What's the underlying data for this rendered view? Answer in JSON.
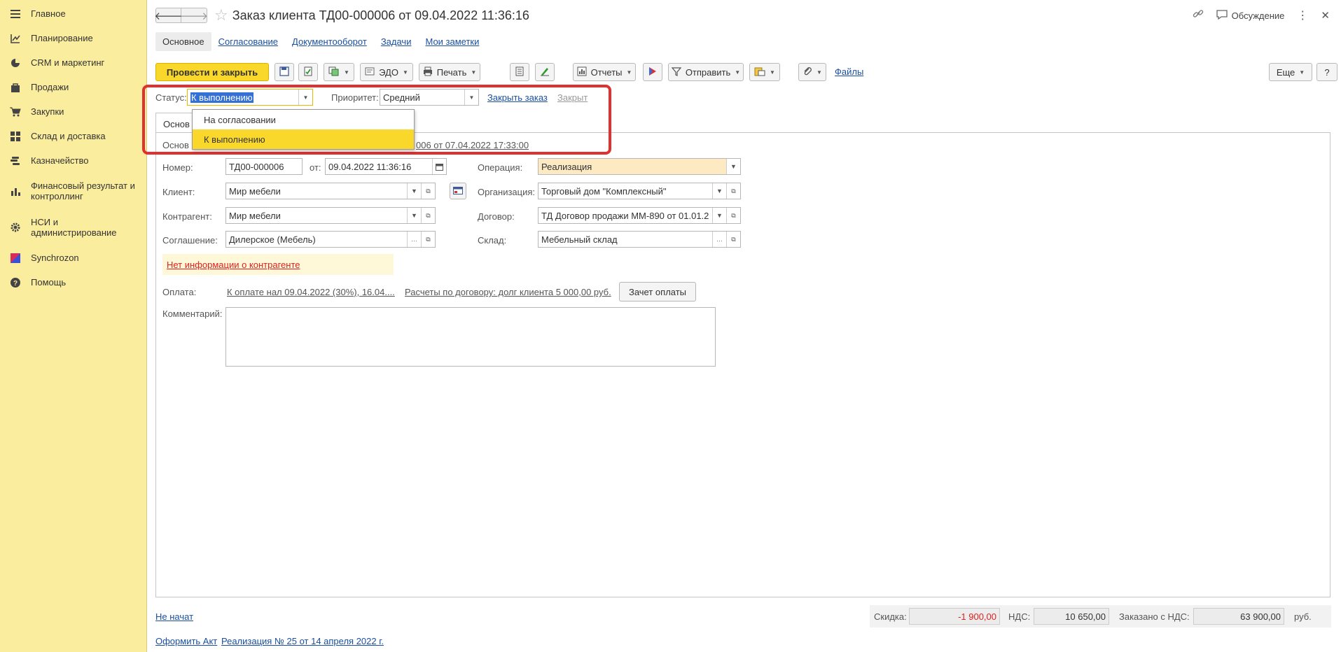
{
  "sidebar": {
    "items": [
      {
        "label": "Главное",
        "icon": "menu-icon"
      },
      {
        "label": "Планирование",
        "icon": "planning-icon"
      },
      {
        "label": "CRM и маркетинг",
        "icon": "pie-chart-icon"
      },
      {
        "label": "Продажи",
        "icon": "shopping-bag-icon"
      },
      {
        "label": "Закупки",
        "icon": "cart-icon"
      },
      {
        "label": "Склад и доставка",
        "icon": "warehouse-icon"
      },
      {
        "label": "Казначейство",
        "icon": "coins-icon"
      },
      {
        "label": "Финансовый результат и контроллинг",
        "icon": "bar-chart-icon"
      },
      {
        "label": "НСИ и администрирование",
        "icon": "gear-icon"
      },
      {
        "label": "Synchrozon",
        "icon": "synchrozon-logo-icon"
      },
      {
        "label": "Помощь",
        "icon": "help-icon"
      }
    ]
  },
  "header": {
    "title": "Заказ клиента ТД00-000006 от 09.04.2022 11:36:16",
    "discuss_label": "Обсуждение",
    "tabs": [
      "Основное",
      "Согласование",
      "Документооборот",
      "Задачи",
      "Мои заметки"
    ]
  },
  "toolbar": {
    "post_close": "Провести и закрыть",
    "edo": "ЭДО",
    "print": "Печать",
    "reports": "Отчеты",
    "send": "Отправить",
    "files": "Файлы",
    "more": "Еще",
    "help": "?"
  },
  "status": {
    "status_label": "Статус:",
    "status_value": "К выполнению",
    "priority_label": "Приоритет:",
    "priority_value": "Средний",
    "close_order": "Закрыть заказ",
    "closed": "Закрыт",
    "options": [
      "На согласовании",
      "К выполнению"
    ]
  },
  "form": {
    "inner_tab": "Основ",
    "basis_label": "Основ",
    "basis_link": "006 от 07.04.2022 17:33:00",
    "number_label": "Номер:",
    "number_value": "ТД00-000006",
    "from_label": "от:",
    "date_value": "09.04.2022 11:36:16",
    "operation_label": "Операция:",
    "operation_value": "Реализация",
    "client_label": "Клиент:",
    "client_value": "Мир мебели",
    "org_label": "Организация:",
    "org_value": "Торговый дом \"Комплексный\"",
    "counterparty_label": "Контрагент:",
    "counterparty_value": "Мир мебели",
    "contract_label": "Договор:",
    "contract_value": "ТД Договор продажи ММ-890 от 01.01.2",
    "agreement_label": "Соглашение:",
    "agreement_value": "Дилерское (Мебель)",
    "warehouse_label": "Склад:",
    "warehouse_value": "Мебельный склад",
    "warning": "Нет информации о контрагенте",
    "payment_label": "Оплата:",
    "payment_link": "К оплате нал 09.04.2022 (30%), 16.04....",
    "settlement_link": "Расчеты по договору: долг клиента 5 000,00 руб.",
    "offset_button": "Зачет оплаты",
    "comment_label": "Комментарий:",
    "comment_value": ""
  },
  "footer": {
    "not_started": "Не начат",
    "make_act": "Оформить Акт",
    "sale_link": "Реализация № 25 от 14 апреля 2022 г.",
    "discount_label": "Скидка:",
    "discount_value": "-1 900,00",
    "vat_label": "НДС:",
    "vat_value": "10 650,00",
    "ordered_label": "Заказано с НДС:",
    "ordered_value": "63 900,00",
    "currency": "руб."
  },
  "colors": {
    "sidebar_bg": "#fbed9e",
    "accent_yellow": "#fad82b",
    "link_blue": "#1a4fa0",
    "highlight_red": "#e03030",
    "negative_red": "#e02020"
  }
}
